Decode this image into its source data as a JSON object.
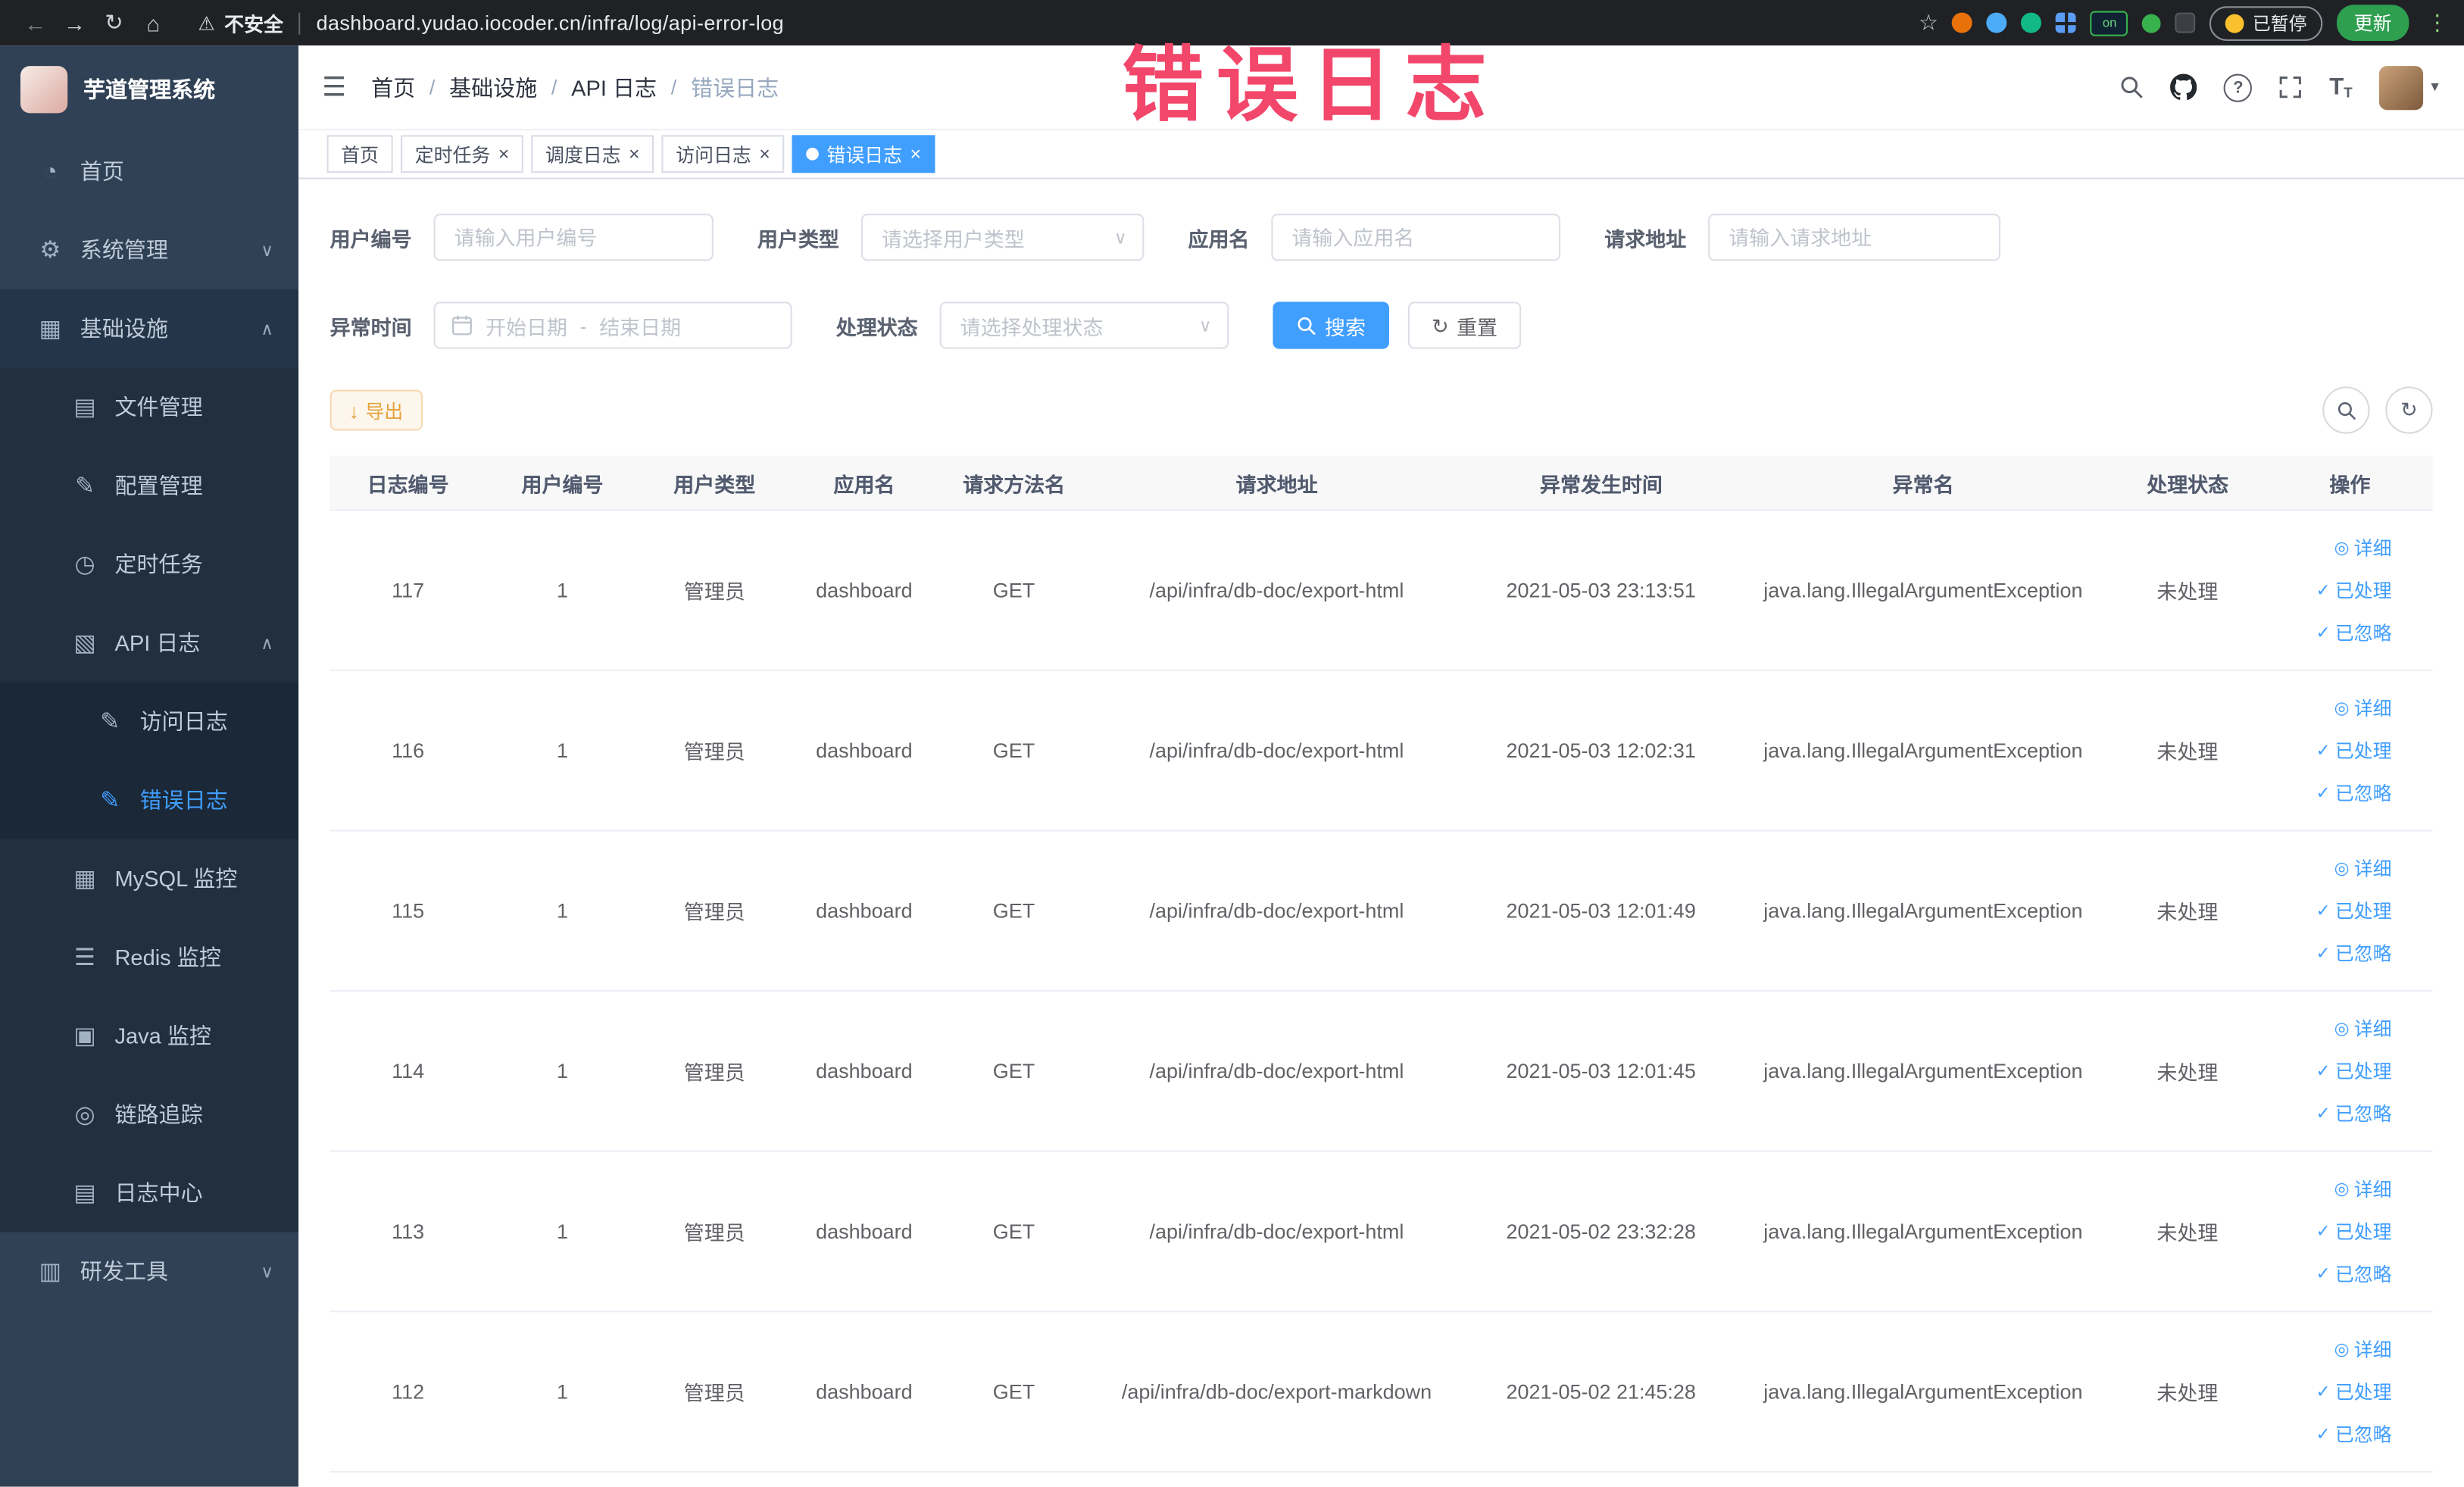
{
  "theme": {
    "accent": "#409eff",
    "warning": "#e6a23c",
    "annotation_color": "#f2476a",
    "sidebar_bg": "#304156",
    "chrome_bg": "#1f2125"
  },
  "browser": {
    "back_icon": "←",
    "forward_icon": "→",
    "reload_icon": "↻",
    "home_icon": "⌂",
    "warning_icon": "⚠",
    "security_label": "不安全",
    "url": "dashboard.yudao.iocoder.cn/infra/log/api-error-log",
    "star_icon": "☆",
    "ext_on_label": "on",
    "paused_label": "已暂停",
    "update_label": "更新",
    "menu_icon": "⋮"
  },
  "annotation": {
    "text": "错误日志"
  },
  "sidebar": {
    "logo_title": "芋道管理系统",
    "items": [
      {
        "name": "home",
        "label": "首页",
        "glyph": "◔",
        "level": 0
      },
      {
        "name": "system",
        "label": "系统管理",
        "glyph": "⚙",
        "level": 0,
        "arrow": "∨"
      },
      {
        "name": "infra",
        "label": "基础设施",
        "glyph": "▦",
        "level": 0,
        "arrow": "∧",
        "open": true
      },
      {
        "name": "file-manage",
        "label": "文件管理",
        "glyph": "▤",
        "level": 1
      },
      {
        "name": "config-manage",
        "label": "配置管理",
        "glyph": "✎",
        "level": 1
      },
      {
        "name": "scheduled-jobs",
        "label": "定时任务",
        "glyph": "◷",
        "level": 1
      },
      {
        "name": "api-log",
        "label": "API 日志",
        "glyph": "▧",
        "level": 1,
        "arrow": "∧",
        "open": true
      },
      {
        "name": "access-log",
        "label": "访问日志",
        "glyph": "✎",
        "level": 2
      },
      {
        "name": "error-log",
        "label": "错误日志",
        "glyph": "✎",
        "level": 2,
        "active": true
      },
      {
        "name": "mysql-monitor",
        "label": "MySQL 监控",
        "glyph": "▦",
        "level": 1
      },
      {
        "name": "redis-monitor",
        "label": "Redis 监控",
        "glyph": "☰",
        "level": 1
      },
      {
        "name": "java-monitor",
        "label": "Java 监控",
        "glyph": "▣",
        "level": 1
      },
      {
        "name": "tracing",
        "label": "链路追踪",
        "glyph": "◎",
        "level": 1
      },
      {
        "name": "log-center",
        "label": "日志中心",
        "glyph": "▤",
        "level": 1
      },
      {
        "name": "dev-tools",
        "label": "研发工具",
        "glyph": "▥",
        "level": 0,
        "arrow": "∨"
      }
    ]
  },
  "topbar": {
    "hamburger_icon": "☰",
    "separator": "/",
    "breadcrumb": [
      {
        "label": "首页"
      },
      {
        "label": "基础设施"
      },
      {
        "label": "API 日志"
      },
      {
        "label": "错误日志"
      }
    ]
  },
  "tabs": [
    {
      "label": "首页",
      "closable": false,
      "active": false
    },
    {
      "label": "定时任务",
      "closable": true,
      "active": false
    },
    {
      "label": "调度日志",
      "closable": true,
      "active": false
    },
    {
      "label": "访问日志",
      "closable": true,
      "active": false
    },
    {
      "label": "错误日志",
      "closable": true,
      "active": true
    }
  ],
  "filters": {
    "user_id": {
      "label": "用户编号",
      "placeholder": "请输入用户编号"
    },
    "user_type": {
      "label": "用户类型",
      "placeholder": "请选择用户类型"
    },
    "app_name": {
      "label": "应用名",
      "placeholder": "请输入应用名"
    },
    "request_url": {
      "label": "请求地址",
      "placeholder": "请输入请求地址"
    },
    "exception_time": {
      "label": "异常时间",
      "start_placeholder": "开始日期",
      "separator": "-",
      "end_placeholder": "结束日期"
    },
    "process_status": {
      "label": "处理状态",
      "placeholder": "请选择处理状态"
    },
    "search_label": "搜索",
    "reset_label": "重置"
  },
  "toolbar": {
    "export_label": "导出"
  },
  "table": {
    "columns": [
      {
        "label": "日志编号"
      },
      {
        "label": "用户编号"
      },
      {
        "label": "用户类型"
      },
      {
        "label": "应用名"
      },
      {
        "label": "请求方法名"
      },
      {
        "label": "请求地址"
      },
      {
        "label": "异常发生时间"
      },
      {
        "label": "异常名"
      },
      {
        "label": "处理状态"
      },
      {
        "label": "操作"
      }
    ],
    "action_labels": {
      "detail": "详细",
      "processed": "已处理",
      "ignored": "已忽略"
    },
    "rows": [
      {
        "id": "117",
        "user_id": "1",
        "user_type": "管理员",
        "app": "dashboard",
        "method": "GET",
        "url": "/api/infra/db-doc/export-html",
        "time": "2021-05-03 23:13:51",
        "exception": "java.lang.IllegalArgumentException",
        "status": "未处理"
      },
      {
        "id": "116",
        "user_id": "1",
        "user_type": "管理员",
        "app": "dashboard",
        "method": "GET",
        "url": "/api/infra/db-doc/export-html",
        "time": "2021-05-03 12:02:31",
        "exception": "java.lang.IllegalArgumentException",
        "status": "未处理"
      },
      {
        "id": "115",
        "user_id": "1",
        "user_type": "管理员",
        "app": "dashboard",
        "method": "GET",
        "url": "/api/infra/db-doc/export-html",
        "time": "2021-05-03 12:01:49",
        "exception": "java.lang.IllegalArgumentException",
        "status": "未处理"
      },
      {
        "id": "114",
        "user_id": "1",
        "user_type": "管理员",
        "app": "dashboard",
        "method": "GET",
        "url": "/api/infra/db-doc/export-html",
        "time": "2021-05-03 12:01:45",
        "exception": "java.lang.IllegalArgumentException",
        "status": "未处理"
      },
      {
        "id": "113",
        "user_id": "1",
        "user_type": "管理员",
        "app": "dashboard",
        "method": "GET",
        "url": "/api/infra/db-doc/export-html",
        "time": "2021-05-02 23:32:28",
        "exception": "java.lang.IllegalArgumentException",
        "status": "未处理"
      },
      {
        "id": "112",
        "user_id": "1",
        "user_type": "管理员",
        "app": "dashboard",
        "method": "GET",
        "url": "/api/infra/db-doc/export-markdown",
        "time": "2021-05-02 21:45:28",
        "exception": "java.lang.IllegalArgumentException",
        "status": "未处理"
      }
    ]
  },
  "ui": {
    "select_arrow": "∨",
    "close_glyph": "×",
    "caret_down": "▾",
    "help_glyph": "?",
    "font_icon": "T",
    "detail_icon": "◎",
    "check_icon": "✓",
    "reset_icon": "↻",
    "export_icon": "↓",
    "refresh_icon": "↻"
  }
}
